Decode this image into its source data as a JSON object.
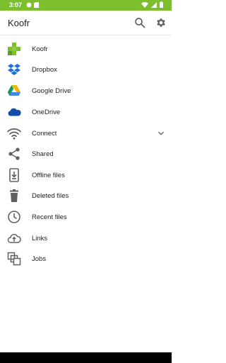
{
  "status": {
    "time": "3:07"
  },
  "header": {
    "title": "Koofr"
  },
  "menu": [
    {
      "label": "Koofr",
      "icon": "koofr-logo-icon"
    },
    {
      "label": "Dropbox",
      "icon": "dropbox-icon"
    },
    {
      "label": "Google Drive",
      "icon": "google-drive-icon"
    },
    {
      "label": "OneDrive",
      "icon": "onedrive-icon"
    },
    {
      "label": "Connect",
      "icon": "wifi-icon"
    },
    {
      "label": "Shared",
      "icon": "share-icon"
    },
    {
      "label": "Offline files",
      "icon": "offline-files-icon"
    },
    {
      "label": "Deleted files",
      "icon": "trash-icon"
    },
    {
      "label": "Recent files",
      "icon": "clock-icon"
    },
    {
      "label": "Links",
      "icon": "cloud-upload-icon"
    },
    {
      "label": "Jobs",
      "icon": "jobs-icon"
    }
  ],
  "colors": {
    "accent": "#7cbe2d",
    "icon": "#616161"
  }
}
